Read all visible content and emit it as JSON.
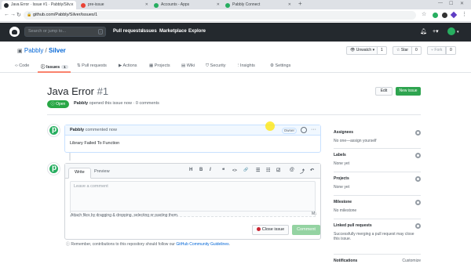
{
  "browser": {
    "tabs": [
      {
        "title": "Java Error · Issue #1 · Pabbly/Silv...",
        "active": true,
        "icon": "github-icon",
        "color": "#24292e"
      },
      {
        "title": "pre-issue",
        "active": false,
        "icon": "gmail-icon",
        "color": "#ea4335"
      },
      {
        "title": "Accounts - Apps",
        "active": false,
        "icon": "pabbly-icon",
        "color": "#27ae60"
      },
      {
        "title": "Pabbly Connect",
        "active": false,
        "icon": "pabbly-icon",
        "color": "#27ae60"
      }
    ],
    "new_tab": "+",
    "url": "github.com/Pabbly/Silver/issues/1"
  },
  "gh_header": {
    "search_placeholder": "Search or jump to...",
    "search_shortcut": "/",
    "nav": [
      "Pull requests",
      "Issues",
      "Marketplace",
      "Explore"
    ]
  },
  "repo": {
    "owner": "Pabbly",
    "separator": " / ",
    "name": "Silver",
    "unwatch_label": "Unwatch",
    "unwatch_count": "1",
    "star_label": "Star",
    "star_count": "0",
    "fork_label": "Fork",
    "fork_count": "0",
    "tabs": [
      {
        "label": "Code",
        "icon": "code-icon"
      },
      {
        "label": "Issues",
        "icon": "issue-icon",
        "count": "1",
        "selected": true
      },
      {
        "label": "Pull requests",
        "icon": "pull-request-icon"
      },
      {
        "label": "Actions",
        "icon": "play-icon"
      },
      {
        "label": "Projects",
        "icon": "project-icon"
      },
      {
        "label": "Wiki",
        "icon": "book-icon"
      },
      {
        "label": "Security",
        "icon": "shield-icon"
      },
      {
        "label": "Insights",
        "icon": "graph-icon"
      },
      {
        "label": "Settings",
        "icon": "gear-icon"
      }
    ]
  },
  "issue": {
    "title": "Java Error",
    "number": "#1",
    "edit_label": "Edit",
    "new_issue_label": "New issue",
    "status": "Open",
    "author": "Pabbly",
    "meta_rest": " opened this issue now · 0 comments"
  },
  "comment": {
    "author": "Pabbly",
    "time": " commented now",
    "owner_badge": "Owner",
    "more": "···",
    "body": "Library Failed To Function"
  },
  "editor": {
    "write_tab": "Write",
    "preview_tab": "Preview",
    "tools": [
      "H",
      "B",
      "I",
      "❝",
      "<>",
      "🔗",
      "☰",
      "☷",
      "☑",
      "@",
      "⤴",
      "↶"
    ],
    "placeholder": "Leave a comment",
    "attach_hint": "Attach files by dragging & dropping, selecting or pasting them.",
    "close_issue_label": "Close issue",
    "comment_label": "Comment"
  },
  "remember": {
    "text": "Remember, contributions to this repository should follow our ",
    "link": "GitHub Community Guidelines",
    "end": "."
  },
  "sidebar": [
    {
      "label": "Assignees",
      "value": "No one—assign yourself"
    },
    {
      "label": "Labels",
      "value": "None yet"
    },
    {
      "label": "Projects",
      "value": "None yet"
    },
    {
      "label": "Milestone",
      "value": "No milestone"
    },
    {
      "label": "Linked pull requests",
      "value": "Successfully merging a pull request may close this issue."
    },
    {
      "label": "Notifications",
      "value": "Customize"
    }
  ],
  "colors": {
    "github_header": "#24292e",
    "open_green": "#28a745",
    "new_issue_green": "#2ea44f",
    "link_blue": "#0366d6",
    "issues_underline": "#f9826c"
  }
}
